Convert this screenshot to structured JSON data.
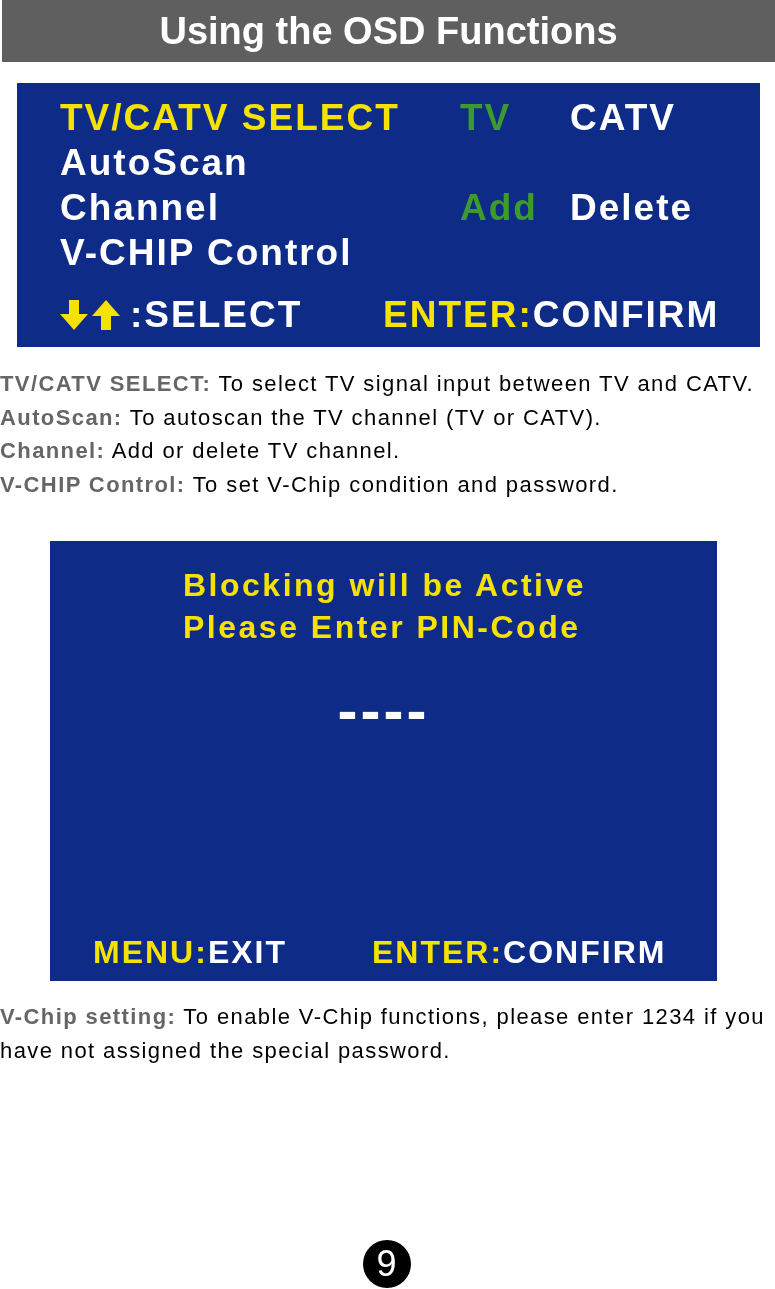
{
  "header": {
    "title": "Using the OSD Functions"
  },
  "osd_menu": {
    "items": [
      {
        "label": "TV/CATV SELECT",
        "selected": true,
        "options": [
          {
            "label": "TV",
            "selected": true
          },
          {
            "label": "CATV",
            "selected": false
          }
        ]
      },
      {
        "label": "AutoScan",
        "selected": false
      },
      {
        "label": "Channel",
        "selected": false,
        "options": [
          {
            "label": "Add",
            "selected": true
          },
          {
            "label": "Delete",
            "selected": false
          }
        ]
      },
      {
        "label": "V-CHIP Control",
        "selected": false
      }
    ],
    "footer": [
      {
        "kind": "arrows",
        "action": ":SELECT"
      },
      {
        "kind": "key",
        "key": "ENTER:",
        "action": "CONFIRM"
      }
    ]
  },
  "descriptions": [
    {
      "term": "TV/CATV SELECT:",
      "text": "To select TV signal input between TV and CATV."
    },
    {
      "term": "AutoScan:",
      "text": "To autoscan the TV channel (TV or CATV)."
    },
    {
      "term": "Channel:",
      "text": "Add or delete TV channel."
    },
    {
      "term": "V-CHIP Control:",
      "text": "To set V-Chip condition and password."
    }
  ],
  "pin_screen": {
    "message": [
      "Blocking will be Active",
      "Please Enter PIN-Code"
    ],
    "pin_entry": "----",
    "footer": [
      {
        "kind": "key",
        "key": "MENU:",
        "action": "EXIT"
      },
      {
        "kind": "key",
        "key": "ENTER:",
        "action": "CONFIRM"
      }
    ]
  },
  "note": {
    "term": "V-Chip setting:",
    "text": "To enable V-Chip functions, please enter 1234 if you have not assigned the special password."
  },
  "page_number": "9"
}
